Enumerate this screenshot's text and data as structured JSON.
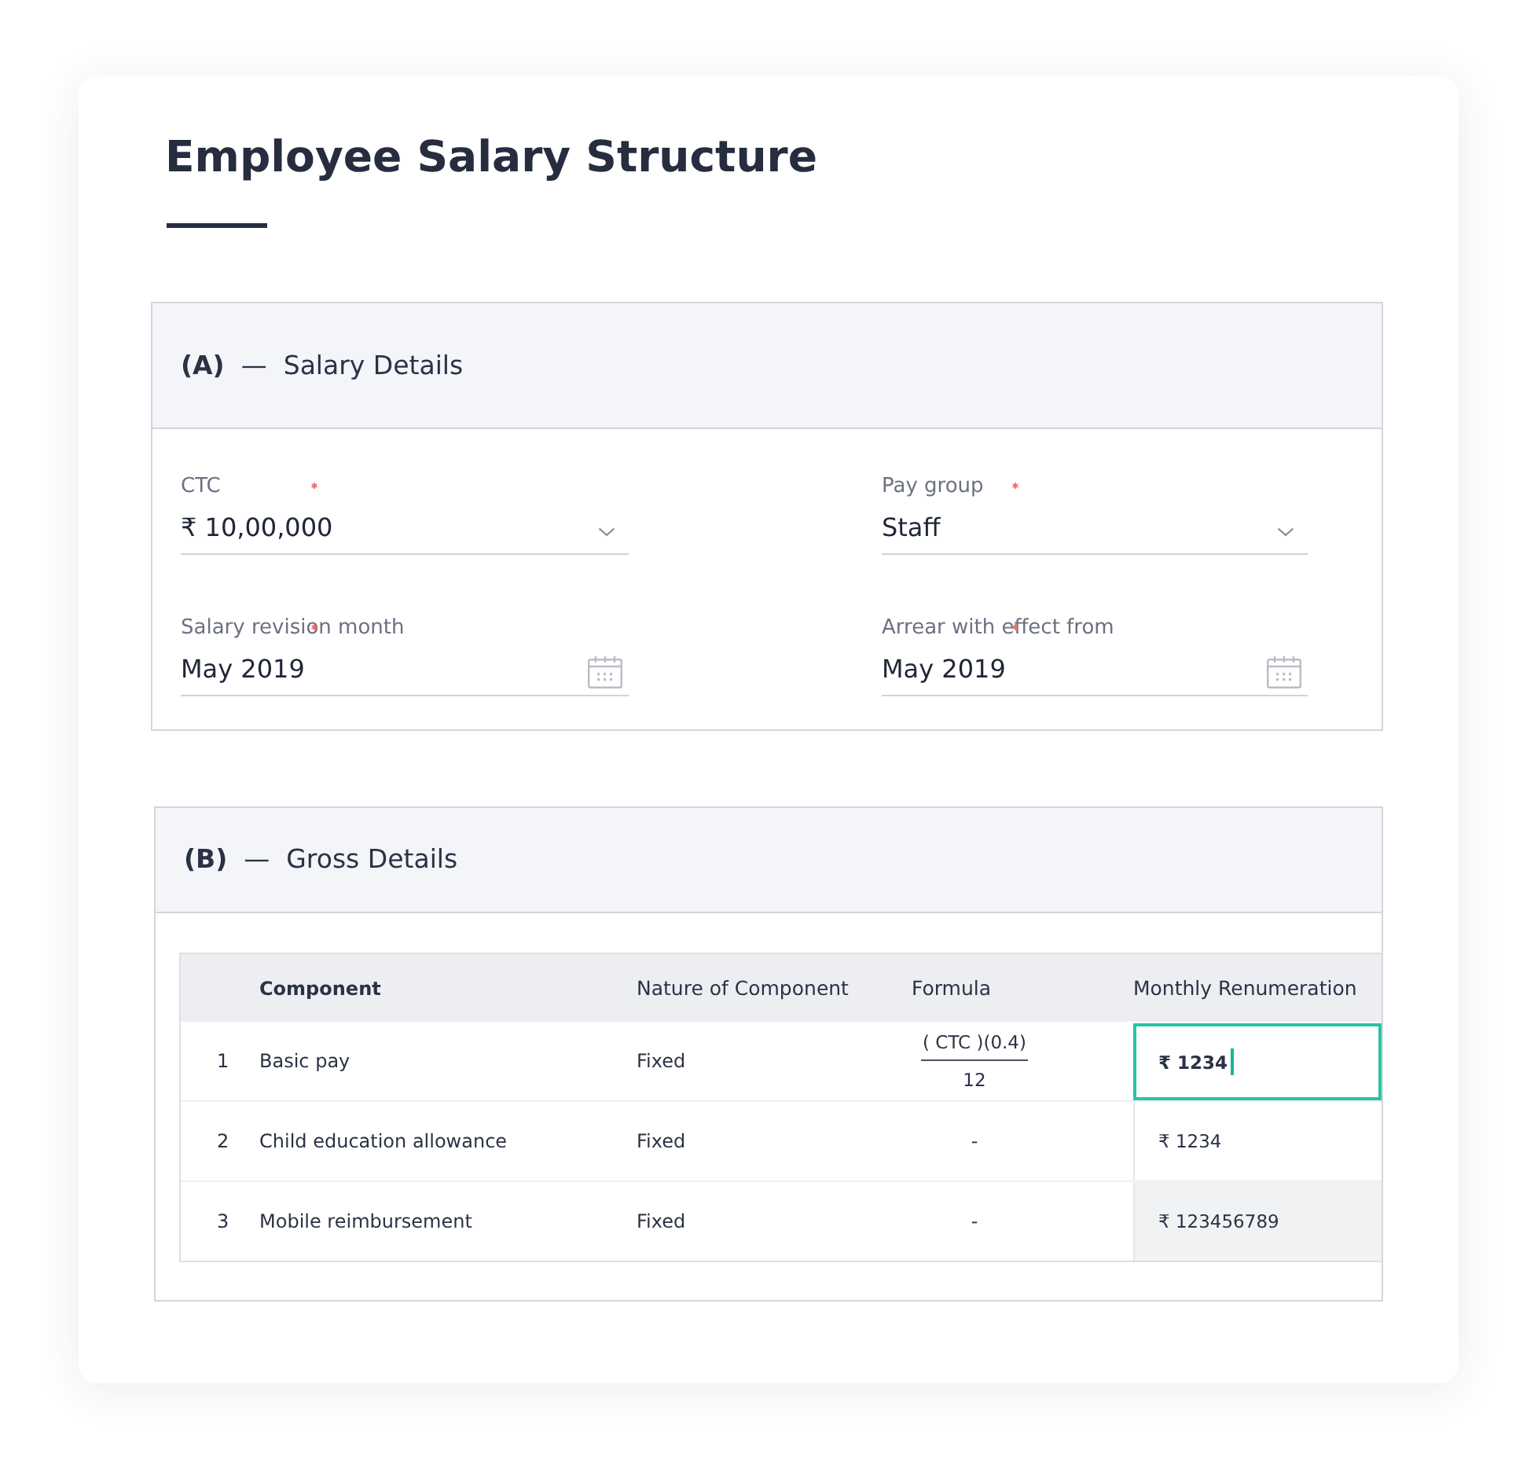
{
  "page": {
    "title": "Employee Salary Structure"
  },
  "salary_details": {
    "heading": "**(A)**  —  Salary Details",
    "fields": [
      {
        "kind": "select",
        "label": "CTC",
        "required": true,
        "value": "₹ 10,00,000"
      },
      {
        "kind": "select",
        "label": "Pay group",
        "required": true,
        "value": "Staff"
      },
      {
        "kind": "date",
        "label": "Salary revision month",
        "required": true,
        "value": "May 2019"
      },
      {
        "kind": "date",
        "label": "Arrear with effect from",
        "required": true,
        "value": "May 2019"
      }
    ]
  },
  "gross_details": {
    "heading": "**(B)**  —  Gross Details",
    "table": {
      "columns": [
        "Component",
        "Nature of Component",
        "Formula",
        "Monthly Renumeration"
      ],
      "rows": [
        {
          "number": "1",
          "component": "Basic pay",
          "nature": "Fixed",
          "formula": {
            "kind": "fraction",
            "numerator": "( CTC )(0.4)",
            "denominator": "12"
          },
          "amount": "₹ 1234",
          "focused": true,
          "readonly": false
        },
        {
          "number": "2",
          "component": "Child education allowance",
          "nature": "Fixed",
          "formula": {
            "kind": "text",
            "text": "-"
          },
          "amount": "₹ 1234",
          "focused": false,
          "readonly": false
        },
        {
          "number": "3",
          "component": "Mobile reimbursement",
          "nature": "Fixed",
          "formula": {
            "kind": "text",
            "text": "-"
          },
          "amount": "₹ 123456789",
          "focused": false,
          "readonly": true
        }
      ]
    }
  }
}
